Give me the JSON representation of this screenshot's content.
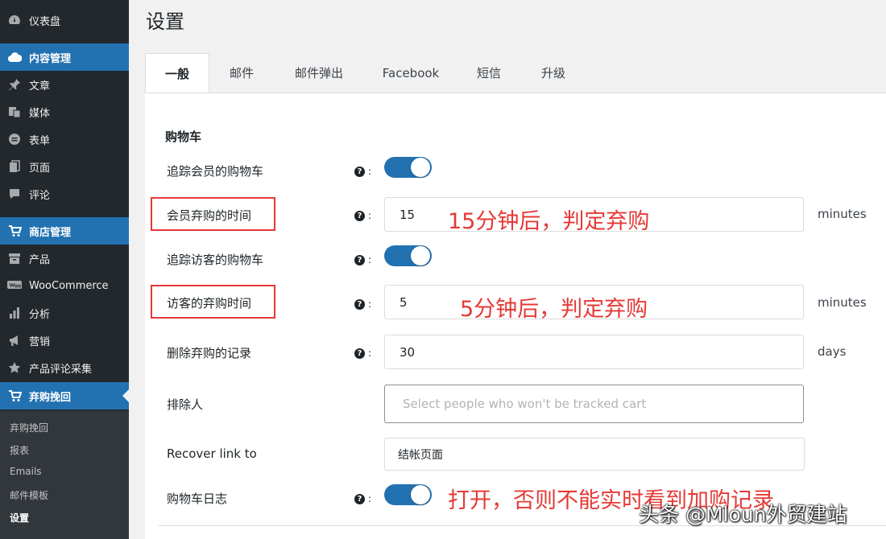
{
  "sidebar": {
    "items": [
      {
        "label": "仪表盘",
        "icon": "dashboard-icon"
      },
      {
        "label": "内容管理",
        "icon": "cloud-icon"
      },
      {
        "label": "文章",
        "icon": "pin-icon"
      },
      {
        "label": "媒体",
        "icon": "media-icon"
      },
      {
        "label": "表单",
        "icon": "form-icon"
      },
      {
        "label": "页面",
        "icon": "page-icon"
      },
      {
        "label": "评论",
        "icon": "comment-icon"
      },
      {
        "label": "商店管理",
        "icon": "cart-icon"
      },
      {
        "label": "产品",
        "icon": "archive-icon"
      },
      {
        "label": "WooCommerce",
        "icon": "woo-icon"
      },
      {
        "label": "分析",
        "icon": "chart-icon"
      },
      {
        "label": "营销",
        "icon": "megaphone-icon"
      },
      {
        "label": "产品评论采集",
        "icon": "star-icon"
      },
      {
        "label": "弃购挽回",
        "icon": "cart-icon"
      }
    ],
    "submenu": [
      "弃购挽回",
      "报表",
      "Emails",
      "邮件模板",
      "设置"
    ]
  },
  "page_title": "设置",
  "tabs": [
    "一般",
    "邮件",
    "邮件弹出",
    "Facebook",
    "短信",
    "升级"
  ],
  "section_title": "购物车",
  "fields": {
    "track_member_cart": {
      "label": "追踪会员的购物车",
      "enabled": true
    },
    "member_abandon_time": {
      "label": "会员弃购的时间",
      "value": "15",
      "unit": "minutes"
    },
    "track_guest_cart": {
      "label": "追踪访客的购物车",
      "enabled": true
    },
    "guest_abandon_time": {
      "label": "访客的弃购时间",
      "value": "5",
      "unit": "minutes"
    },
    "delete_abandoned_records": {
      "label": "删除弃购的记录",
      "value": "30",
      "unit": "days"
    },
    "exclude_people": {
      "label": "排除人",
      "placeholder": "Select people who won't be tracked cart"
    },
    "recover_link": {
      "label": "Recover link to",
      "value": "结帐页面"
    },
    "cart_log": {
      "label": "购物车日志",
      "enabled": true
    }
  },
  "help_suffix": ":",
  "help_mark": "?",
  "annotations": {
    "member": "15分钟后，判定弃购",
    "guest": "5分钟后，判定弃购",
    "log": "打开，否则不能实时看到加购记录"
  },
  "watermark": "头条 @Mloun外贸建站",
  "colors": {
    "accent": "#2271b1",
    "annotation": "#e53935",
    "sidebar": "#23282d"
  }
}
